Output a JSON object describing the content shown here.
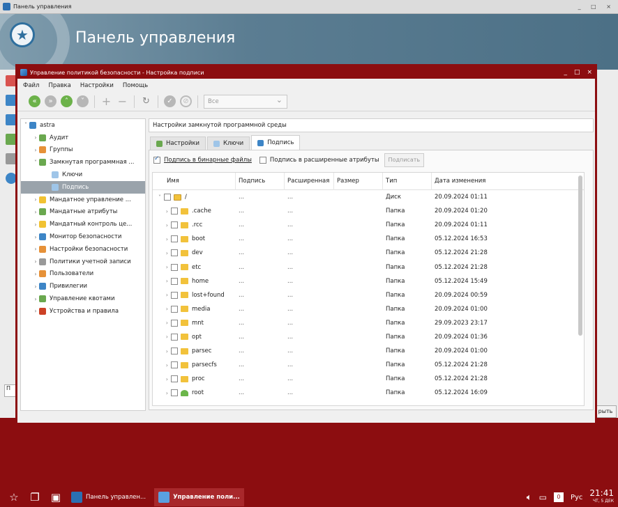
{
  "background_window": {
    "titlebar": "Панель управления",
    "titlebar_buttons": "_ □ ×",
    "header_title": "Панель управления",
    "bottom_left_text": "П",
    "bottom_right_text": "рыть"
  },
  "dialog": {
    "title": "Управление политикой безопасности - Настройка подписи",
    "window_buttons": [
      "_",
      "□",
      "×"
    ],
    "menu": [
      "Файл",
      "Правка",
      "Настройки",
      "Помощь"
    ],
    "toolbar_select": "Все"
  },
  "tree": {
    "root": "astra",
    "items": [
      {
        "label": "Аудит",
        "color": "#6aa84f",
        "indent": 1
      },
      {
        "label": "Группы",
        "color": "#e69138",
        "indent": 1
      },
      {
        "label": "Замкнутая программная ...",
        "color": "#6aa84f",
        "indent": 1
      },
      {
        "label": "Ключи",
        "color": "#9fc5e8",
        "indent": 2
      },
      {
        "label": "Подпись",
        "color": "#9fc5e8",
        "indent": 2,
        "selected": true
      },
      {
        "label": "Мандатное управление ...",
        "color": "#f1c232",
        "indent": 1
      },
      {
        "label": "Мандатные атрибуты",
        "color": "#6aa84f",
        "indent": 1
      },
      {
        "label": "Мандатный контроль це...",
        "color": "#f1c232",
        "indent": 1
      },
      {
        "label": "Монитор безопасности",
        "color": "#3d85c6",
        "indent": 1
      },
      {
        "label": "Настройки безопасности",
        "color": "#e69138",
        "indent": 1
      },
      {
        "label": "Политики учетной записи",
        "color": "#999999",
        "indent": 1
      },
      {
        "label": "Пользователи",
        "color": "#e69138",
        "indent": 1
      },
      {
        "label": "Привилегии",
        "color": "#3d85c6",
        "indent": 1
      },
      {
        "label": "Управление квотами",
        "color": "#6aa84f",
        "indent": 1
      },
      {
        "label": "Устройства и правила",
        "color": "#cc4125",
        "indent": 1
      }
    ]
  },
  "section_title": "Настройки замкнутой программной среды",
  "tabs": [
    {
      "label": "Настройки",
      "active": false
    },
    {
      "label": "Ключи",
      "active": false
    },
    {
      "label": "Подпись",
      "active": true
    }
  ],
  "options": {
    "binary_label": "Подпись в бинарные файлы",
    "binary_checked": true,
    "ext_label": "Подпись в расширенные атрибуты",
    "ext_checked": false,
    "sign_button": "Подписать"
  },
  "table": {
    "headers": [
      "Имя",
      "Подпись",
      "Расширенная",
      "Размер",
      "Тип",
      "Дата изменения"
    ],
    "rows": [
      {
        "name": "/",
        "sign": "...",
        "ext": "...",
        "size": "",
        "type": "Диск",
        "date": "20.09.2024 01:11",
        "kind": "root"
      },
      {
        "name": ".cache",
        "sign": "...",
        "ext": "...",
        "size": "",
        "type": "Папка",
        "date": "20.09.2024 01:20",
        "kind": "folder"
      },
      {
        "name": ".rcc",
        "sign": "...",
        "ext": "...",
        "size": "",
        "type": "Папка",
        "date": "20.09.2024 01:11",
        "kind": "folder"
      },
      {
        "name": "boot",
        "sign": "...",
        "ext": "...",
        "size": "",
        "type": "Папка",
        "date": "05.12.2024 16:53",
        "kind": "folder"
      },
      {
        "name": "dev",
        "sign": "...",
        "ext": "...",
        "size": "",
        "type": "Папка",
        "date": "05.12.2024 21:28",
        "kind": "folder"
      },
      {
        "name": "etc",
        "sign": "...",
        "ext": "...",
        "size": "",
        "type": "Папка",
        "date": "05.12.2024 21:28",
        "kind": "folder"
      },
      {
        "name": "home",
        "sign": "...",
        "ext": "...",
        "size": "",
        "type": "Папка",
        "date": "05.12.2024 15:49",
        "kind": "folder"
      },
      {
        "name": "lost+found",
        "sign": "...",
        "ext": "...",
        "size": "",
        "type": "Папка",
        "date": "20.09.2024 00:59",
        "kind": "folder"
      },
      {
        "name": "media",
        "sign": "...",
        "ext": "...",
        "size": "",
        "type": "Папка",
        "date": "20.09.2024 01:00",
        "kind": "folder"
      },
      {
        "name": "mnt",
        "sign": "...",
        "ext": "...",
        "size": "",
        "type": "Папка",
        "date": "29.09.2023 23:17",
        "kind": "folder"
      },
      {
        "name": "opt",
        "sign": "...",
        "ext": "...",
        "size": "",
        "type": "Папка",
        "date": "20.09.2024 01:36",
        "kind": "folder"
      },
      {
        "name": "parsec",
        "sign": "...",
        "ext": "...",
        "size": "",
        "type": "Папка",
        "date": "20.09.2024 01:00",
        "kind": "folder"
      },
      {
        "name": "parsecfs",
        "sign": "...",
        "ext": "...",
        "size": "",
        "type": "Папка",
        "date": "05.12.2024 21:28",
        "kind": "folder"
      },
      {
        "name": "proc",
        "sign": "...",
        "ext": "...",
        "size": "",
        "type": "Папка",
        "date": "05.12.2024 21:28",
        "kind": "folder"
      },
      {
        "name": "root",
        "sign": "...",
        "ext": "...",
        "size": "",
        "type": "Папка",
        "date": "05.12.2024 16:09",
        "kind": "home"
      }
    ]
  },
  "taskbar": {
    "tasks": [
      {
        "label": "Панель управлен...",
        "active": false
      },
      {
        "label": "Управление поли...",
        "active": true
      }
    ],
    "lang": "Рус",
    "time": "21:41",
    "date": "ЧТ, 5 ДЕК"
  }
}
